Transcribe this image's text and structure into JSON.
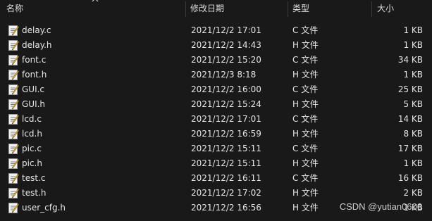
{
  "columns": {
    "name": "名称",
    "date": "修改日期",
    "type": "类型",
    "size": "大小"
  },
  "files": [
    {
      "name": "delay.c",
      "date": "2021/12/2 17:01",
      "type": "C 文件",
      "size": "1 KB"
    },
    {
      "name": "delay.h",
      "date": "2021/12/2 14:43",
      "type": "H 文件",
      "size": "1 KB"
    },
    {
      "name": "font.c",
      "date": "2021/12/2 15:20",
      "type": "C 文件",
      "size": "34 KB"
    },
    {
      "name": "font.h",
      "date": "2021/12/3 8:18",
      "type": "H 文件",
      "size": "1 KB"
    },
    {
      "name": "GUI.c",
      "date": "2021/12/2 16:00",
      "type": "C 文件",
      "size": "25 KB"
    },
    {
      "name": "GUI.h",
      "date": "2021/12/2 15:24",
      "type": "H 文件",
      "size": "5 KB"
    },
    {
      "name": "lcd.c",
      "date": "2021/12/2 17:01",
      "type": "C 文件",
      "size": "14 KB"
    },
    {
      "name": "lcd.h",
      "date": "2021/12/2 16:59",
      "type": "H 文件",
      "size": "8 KB"
    },
    {
      "name": "pic.c",
      "date": "2021/12/2 15:11",
      "type": "C 文件",
      "size": "17 KB"
    },
    {
      "name": "pic.h",
      "date": "2021/12/2 15:11",
      "type": "H 文件",
      "size": "1 KB"
    },
    {
      "name": "test.c",
      "date": "2021/12/2 16:11",
      "type": "C 文件",
      "size": "16 KB"
    },
    {
      "name": "test.h",
      "date": "2021/12/2 17:02",
      "type": "H 文件",
      "size": "2 KB"
    },
    {
      "name": "user_cfg.h",
      "date": "2021/12/2 16:56",
      "type": "H 文件",
      "size": "1 KB"
    }
  ],
  "icons": {
    "file": "text-file-icon",
    "sort": "sort-up-icon"
  },
  "watermark": "CSDN @yutian0606",
  "colors": {
    "background": "#191919",
    "text": "#e6e6e6",
    "separator": "#3a3a3a"
  }
}
